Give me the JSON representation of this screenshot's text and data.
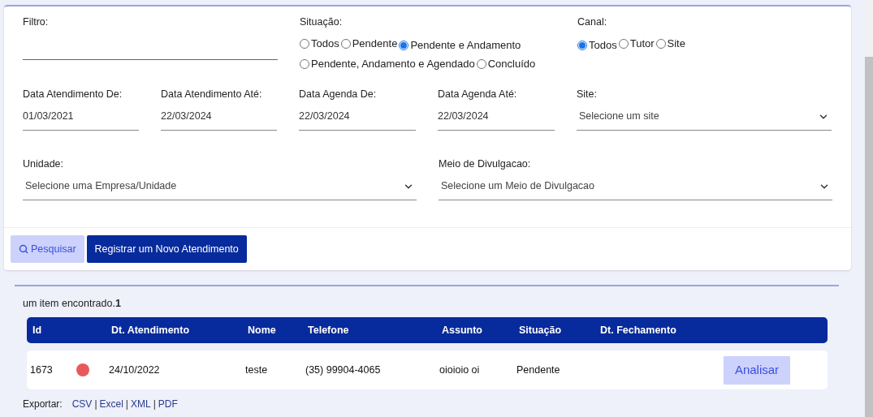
{
  "filters": {
    "filtro": {
      "label": "Filtro:"
    },
    "situacao": {
      "label": "Situação:",
      "options": [
        {
          "label": "Todos",
          "selected": false
        },
        {
          "label": "Pendente",
          "selected": false
        },
        {
          "label": "Pendente e Andamento",
          "selected": true
        },
        {
          "label": "Pendente, Andamento e Agendado",
          "selected": false
        },
        {
          "label": "Concluído",
          "selected": false
        }
      ]
    },
    "canal": {
      "label": "Canal:",
      "options": [
        {
          "label": "Todos",
          "selected": true
        },
        {
          "label": "Tutor",
          "selected": false
        },
        {
          "label": "Site",
          "selected": false
        }
      ]
    },
    "dates": [
      {
        "label": "Data Atendimento De:",
        "value": "01/03/2021"
      },
      {
        "label": "Data Atendimento Até:",
        "value": "22/03/2024"
      },
      {
        "label": "Data Agenda De:",
        "value": "22/03/2024"
      },
      {
        "label": "Data Agenda Até:",
        "value": "22/03/2024"
      }
    ],
    "site": {
      "label": "Site:",
      "placeholder": "Selecione um site"
    },
    "unidade": {
      "label": "Unidade:",
      "placeholder": "Selecione uma Empresa/Unidade"
    },
    "meio": {
      "label": "Meio de Divulgacao:",
      "placeholder": "Selecione um Meio de Divulgacao"
    }
  },
  "buttons": {
    "search": "Pesquisar",
    "register": "Registrar um Novo Atendimento"
  },
  "results": {
    "count": "um item encontrado.**1**",
    "table": {
      "columns": [
        "Id",
        "Dt. Atendimento",
        "Nome",
        "Telefone",
        "Assunto",
        "Situação",
        "Dt. Fechamento"
      ],
      "rows": [
        {
          "id": "1673",
          "color": "#e85a5a",
          "date": "24/10/2022",
          "nome": "teste",
          "telefone": "(35) 99904-4065",
          "assunto": "oioioio oi",
          "situacao": "Pendente",
          "action": "Analisar"
        }
      ]
    },
    "export": {
      "label": "Exportar:",
      "separator": "|",
      "links": [
        "CSV",
        "Excel",
        "XML",
        "PDF"
      ]
    }
  }
}
